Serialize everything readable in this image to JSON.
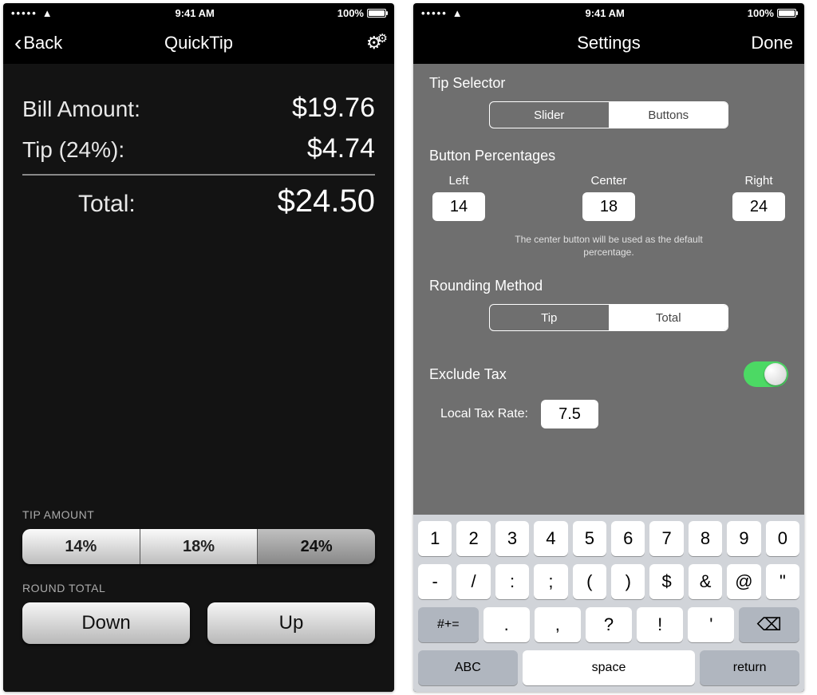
{
  "status": {
    "time": "9:41 AM",
    "battery": "100%"
  },
  "screen1": {
    "nav": {
      "back": "Back",
      "title": "QuickTip"
    },
    "bill": {
      "label": "Bill Amount:",
      "value": "$19.76"
    },
    "tip": {
      "label": "Tip (24%):",
      "value": "$4.74"
    },
    "total": {
      "label": "Total:",
      "value": "$24.50"
    },
    "tipAmountLabel": "TIP AMOUNT",
    "tipOptions": [
      "14%",
      "18%",
      "24%"
    ],
    "tipSelectedIndex": 2,
    "roundLabel": "ROUND TOTAL",
    "roundDown": "Down",
    "roundUp": "Up"
  },
  "screen2": {
    "nav": {
      "title": "Settings",
      "done": "Done"
    },
    "tipSelector": {
      "label": "Tip Selector",
      "options": [
        "Slider",
        "Buttons"
      ],
      "selected": 1
    },
    "buttonPercentages": {
      "label": "Button Percentages",
      "cols": [
        {
          "label": "Left",
          "value": "14"
        },
        {
          "label": "Center",
          "value": "18"
        },
        {
          "label": "Right",
          "value": "24"
        }
      ],
      "hint": "The center button will be used as the default percentage."
    },
    "roundingMethod": {
      "label": "Rounding Method",
      "options": [
        "Tip",
        "Total"
      ],
      "selected": 1
    },
    "excludeTax": {
      "label": "Exclude Tax",
      "on": true,
      "localRateLabel": "Local Tax Rate:",
      "localRate": "7.5"
    }
  },
  "keyboard": {
    "row1": [
      "1",
      "2",
      "3",
      "4",
      "5",
      "6",
      "7",
      "8",
      "9",
      "0"
    ],
    "row2": [
      "-",
      "/",
      ":",
      ";",
      "(",
      ")",
      "$",
      "&",
      "@",
      "\""
    ],
    "row3": {
      "shift": "#+=",
      "keys": [
        ".",
        ",",
        "?",
        "!",
        "'"
      ],
      "del": "⌫"
    },
    "row4": {
      "abc": "ABC",
      "space": "space",
      "return": "return"
    }
  }
}
